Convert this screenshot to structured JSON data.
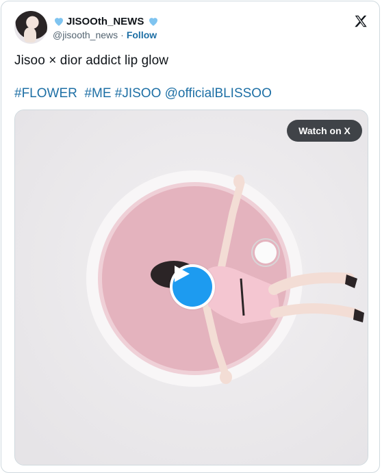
{
  "tweet": {
    "display_name": "JISOOth_NEWS",
    "handle": "@jisooth_news",
    "separator": "·",
    "follow_label": "Follow",
    "text": "Jisoo × dior addict lip glow",
    "hashtags": [
      "#FLOWER",
      "#ME",
      "#JISOO",
      "@officialBLISSOO"
    ]
  },
  "media": {
    "watch_label": "Watch on X"
  },
  "colors": {
    "link": "#1d6fa5",
    "heart": "#7fc4f0",
    "play": "#1d9bf0"
  },
  "icons": {
    "heart": "heart-icon",
    "x_logo": "x-logo-icon",
    "play": "play-icon"
  }
}
